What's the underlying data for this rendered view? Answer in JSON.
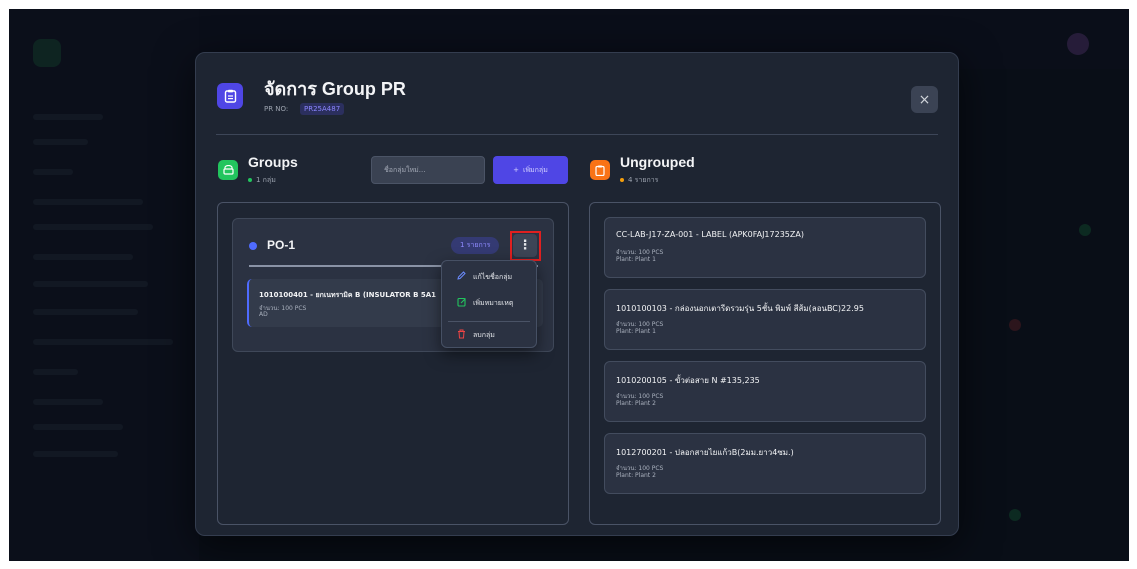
{
  "modal": {
    "title": "จัดการ Group PR",
    "pr_label": "PR NO:",
    "pr_number": "PR25A487",
    "close_label": "×"
  },
  "groups_section": {
    "title": "Groups",
    "count_text": "1 กลุ่ม",
    "new_group_placeholder": "ชื่อกลุ่มใหม่...",
    "add_button_label": "เพิ่มกลุ่ม",
    "add_button_icon": "+",
    "groups": [
      {
        "name": "PO-1",
        "count_badge": "1 รายการ",
        "menu_icon": "⋮",
        "items": [
          {
            "title": "1010100401 - ยกเนทรามิค B (INSULATOR B 5A1",
            "quantity": "จำนวน: 100 PCS",
            "note": "AD"
          }
        ]
      }
    ]
  },
  "group_menu": {
    "items": [
      {
        "label": "แก้ไขชื่อกลุ่ม",
        "icon": "pencil-icon",
        "color": "#6b8cff"
      },
      {
        "label": "เพิ่มหมายเหตุ",
        "icon": "note-edit-icon",
        "color": "#22c55e"
      },
      {
        "label": "ลบกลุ่ม",
        "icon": "trash-icon",
        "color": "#ef4444"
      }
    ]
  },
  "ungrouped_section": {
    "title": "Ungrouped",
    "count_text": "4 รายการ",
    "items": [
      {
        "title": "CC-LAB-J17-ZA-001 - LABEL (APK0FAJ17235ZA)",
        "quantity": "จำนวน: 100 PCS",
        "plant": "Plant: Plant 1"
      },
      {
        "title": "1010100103 - กล่องนอกเตารีดรวมรุ่น 5ชั้น พิมพ์ สีส้ม(ลอนBC)22.95",
        "quantity": "จำนวน: 100 PCS",
        "plant": "Plant: Plant 1"
      },
      {
        "title": "1010200105 - ขั้วต่อสาย N #135,235",
        "quantity": "จำนวน: 100 PCS",
        "plant": "Plant: Plant 2"
      },
      {
        "title": "1012700201 - ปลอกสายไยแก้วB(2มม.ยาว4ซม.)",
        "quantity": "จำนวน: 100 PCS",
        "plant": "Plant: Plant 2"
      }
    ]
  },
  "colors": {
    "accent": "#4f46e5",
    "groups_icon_bg": "#22c55e",
    "ungrouped_icon_bg": "#f97316",
    "highlight": "#e02020"
  }
}
